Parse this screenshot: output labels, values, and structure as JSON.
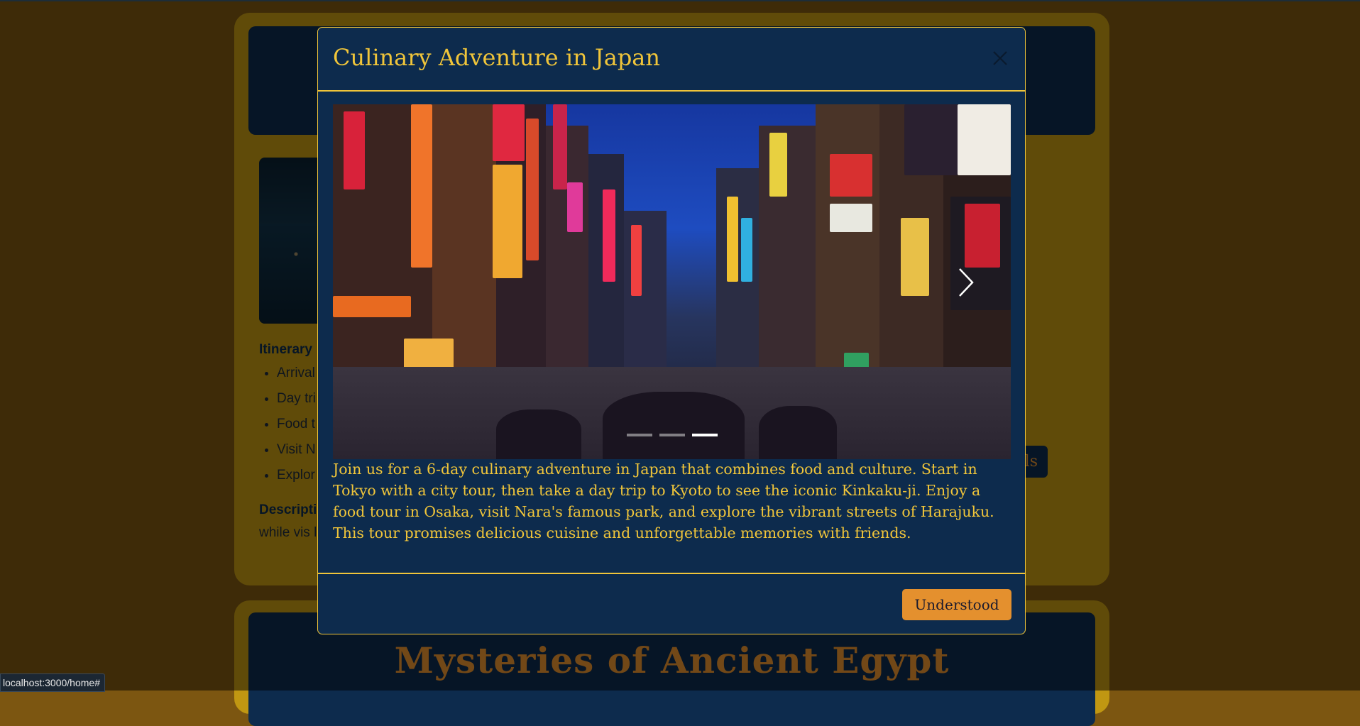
{
  "background_page": {
    "itinerary_title": "Itinerary",
    "itinerary_items": [
      "Arrival",
      "Day tri",
      "Food t",
      "Visit N",
      "Explor"
    ],
    "description_title": "Descripti",
    "description_text": "while vis local cult",
    "details_button": "Details",
    "next_tour_title": "Mysteries of Ancient Egypt"
  },
  "modal": {
    "title": "Culinary Adventure in Japan",
    "close_label": "×",
    "body_text": "Join us for a 6-day culinary adventure in Japan that combines food and culture. Start in Tokyo with a city tour, then take a day trip to Kyoto to see the iconic Kinkaku-ji. Enjoy a food tour in Osaka, visit Nara's famous park, and explore the vibrant streets of Harajuku. This tour promises delicious cuisine and unforgettable memories with friends.",
    "confirm_button": "Understood",
    "carousel": {
      "slide_count": 3,
      "active_index": 2,
      "next_icon": "chevron-right-icon"
    }
  },
  "status_bar": {
    "url": "localhost:3000/home#"
  },
  "colors": {
    "accent_gold": "#f0c53a",
    "navy": "#0d2b4d",
    "orange": "#e4902e"
  }
}
